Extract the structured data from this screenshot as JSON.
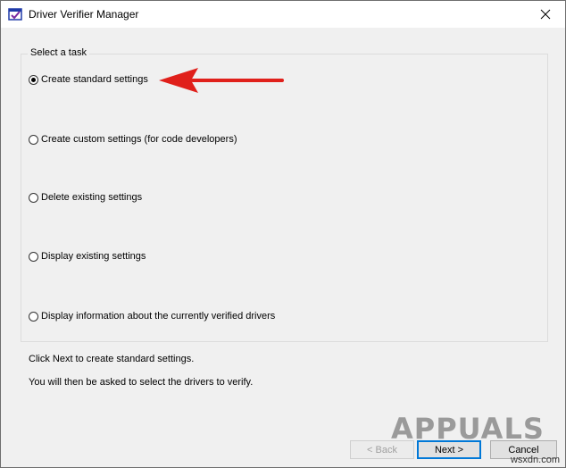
{
  "window": {
    "title": "Driver Verifier Manager",
    "icon": "driver-verifier-icon",
    "close_icon": "close-icon"
  },
  "group": {
    "legend": "Select a task",
    "options": [
      {
        "label": "Create standard settings",
        "checked": true
      },
      {
        "label": "Create custom settings (for code developers)",
        "checked": false
      },
      {
        "label": "Delete existing settings",
        "checked": false
      },
      {
        "label": "Display existing settings",
        "checked": false
      },
      {
        "label": "Display information about the currently verified drivers",
        "checked": false
      }
    ]
  },
  "info": {
    "line1": "Click Next to create standard settings.",
    "line2": "You will then be asked to select the drivers to verify."
  },
  "buttons": {
    "back": "< Back",
    "next": "Next >",
    "cancel": "Cancel"
  },
  "annotation": {
    "arrow_color": "#e0201b"
  },
  "watermark": {
    "brand": "APPUALS",
    "site": "wsxdn.com"
  }
}
